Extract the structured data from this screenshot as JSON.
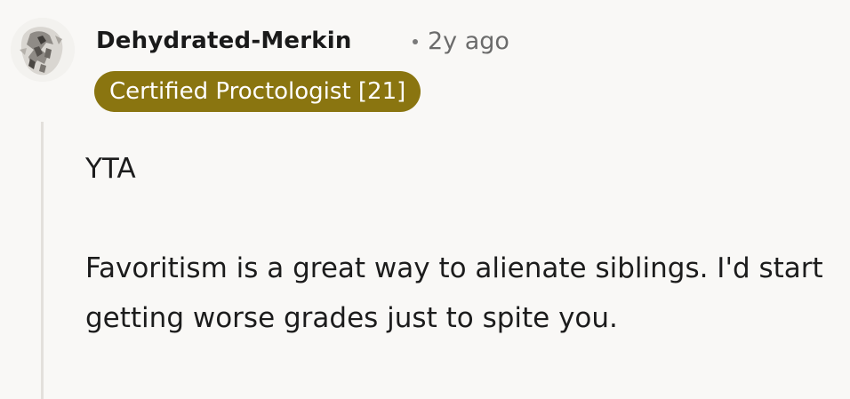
{
  "comment": {
    "author": "Dehydrated-Merkin",
    "separator": "•",
    "time_ago": "2y ago",
    "flair": "Certified Proctologist [21]",
    "paragraphs": [
      "YTA",
      "Favoritism is a great way to alienate siblings. I'd start getting worse grades just to spite you."
    ]
  },
  "colors": {
    "background": "#f9f8f6",
    "flair_background": "#8a7510",
    "flair_text": "#ffffff",
    "meta_text": "#6b6b6b",
    "thread_line": "#e3e0dc"
  },
  "icons": {
    "avatar": "user-avatar-image"
  }
}
